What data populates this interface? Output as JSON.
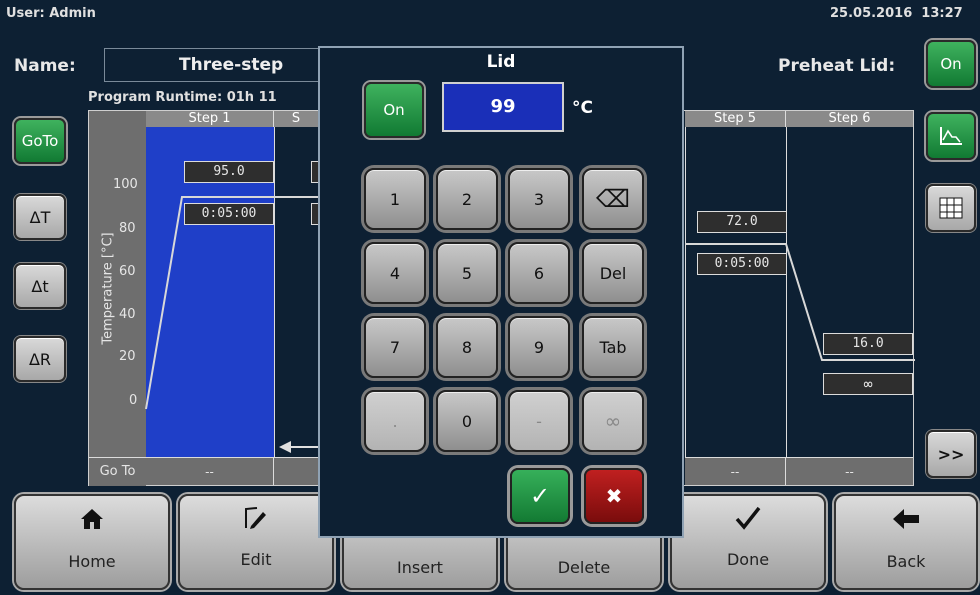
{
  "header": {
    "user": "User: Admin",
    "datetime": "25.05.2016  13:27",
    "name_label": "Name:",
    "name_value": "Three-step",
    "preheat_label": "Preheat Lid:",
    "preheat_state": "On",
    "runtime": "Program Runtime:  01h 11"
  },
  "side_buttons": {
    "goto": "GoTo",
    "delta_temp": "ΔT",
    "delta_time": "Δt",
    "delta_rate": "ΔR",
    "next": ">>"
  },
  "graph": {
    "y_axis_label": "Temperature [°C]",
    "y_ticks": [
      "100",
      "80",
      "60",
      "40",
      "20",
      "0"
    ],
    "goto_label": "Go To",
    "steps": [
      {
        "label": "Step 1",
        "temp": "95.0",
        "time": "0:05:00",
        "goto": "--"
      },
      {
        "label": "S",
        "temp": "",
        "time": "",
        "goto": ""
      },
      {
        "label": "Step 5",
        "temp": "72.0",
        "time": "0:05:00",
        "goto": "--"
      },
      {
        "label": "Step 6",
        "temp": "16.0",
        "time": "∞",
        "goto": "--"
      }
    ]
  },
  "bottom_nav": [
    "Home",
    "Edit",
    "Insert",
    "Delete",
    "Done",
    "Back"
  ],
  "dialog": {
    "title": "Lid",
    "toggle": "On",
    "value": "99",
    "unit": "°C",
    "keys": [
      [
        "1",
        "2",
        "3",
        "⌫"
      ],
      [
        "4",
        "5",
        "6",
        "Del"
      ],
      [
        "7",
        "8",
        "9",
        "Tab"
      ],
      [
        ".",
        "0",
        "-",
        "∞"
      ]
    ],
    "ok": "✓",
    "cancel": "✖"
  },
  "colors": {
    "background": "#0d2033",
    "selected_step": "#1f3fc8",
    "value_display": "#1a2fb8",
    "ok_green": "#1e8f3e",
    "cancel_red": "#9b1414"
  }
}
